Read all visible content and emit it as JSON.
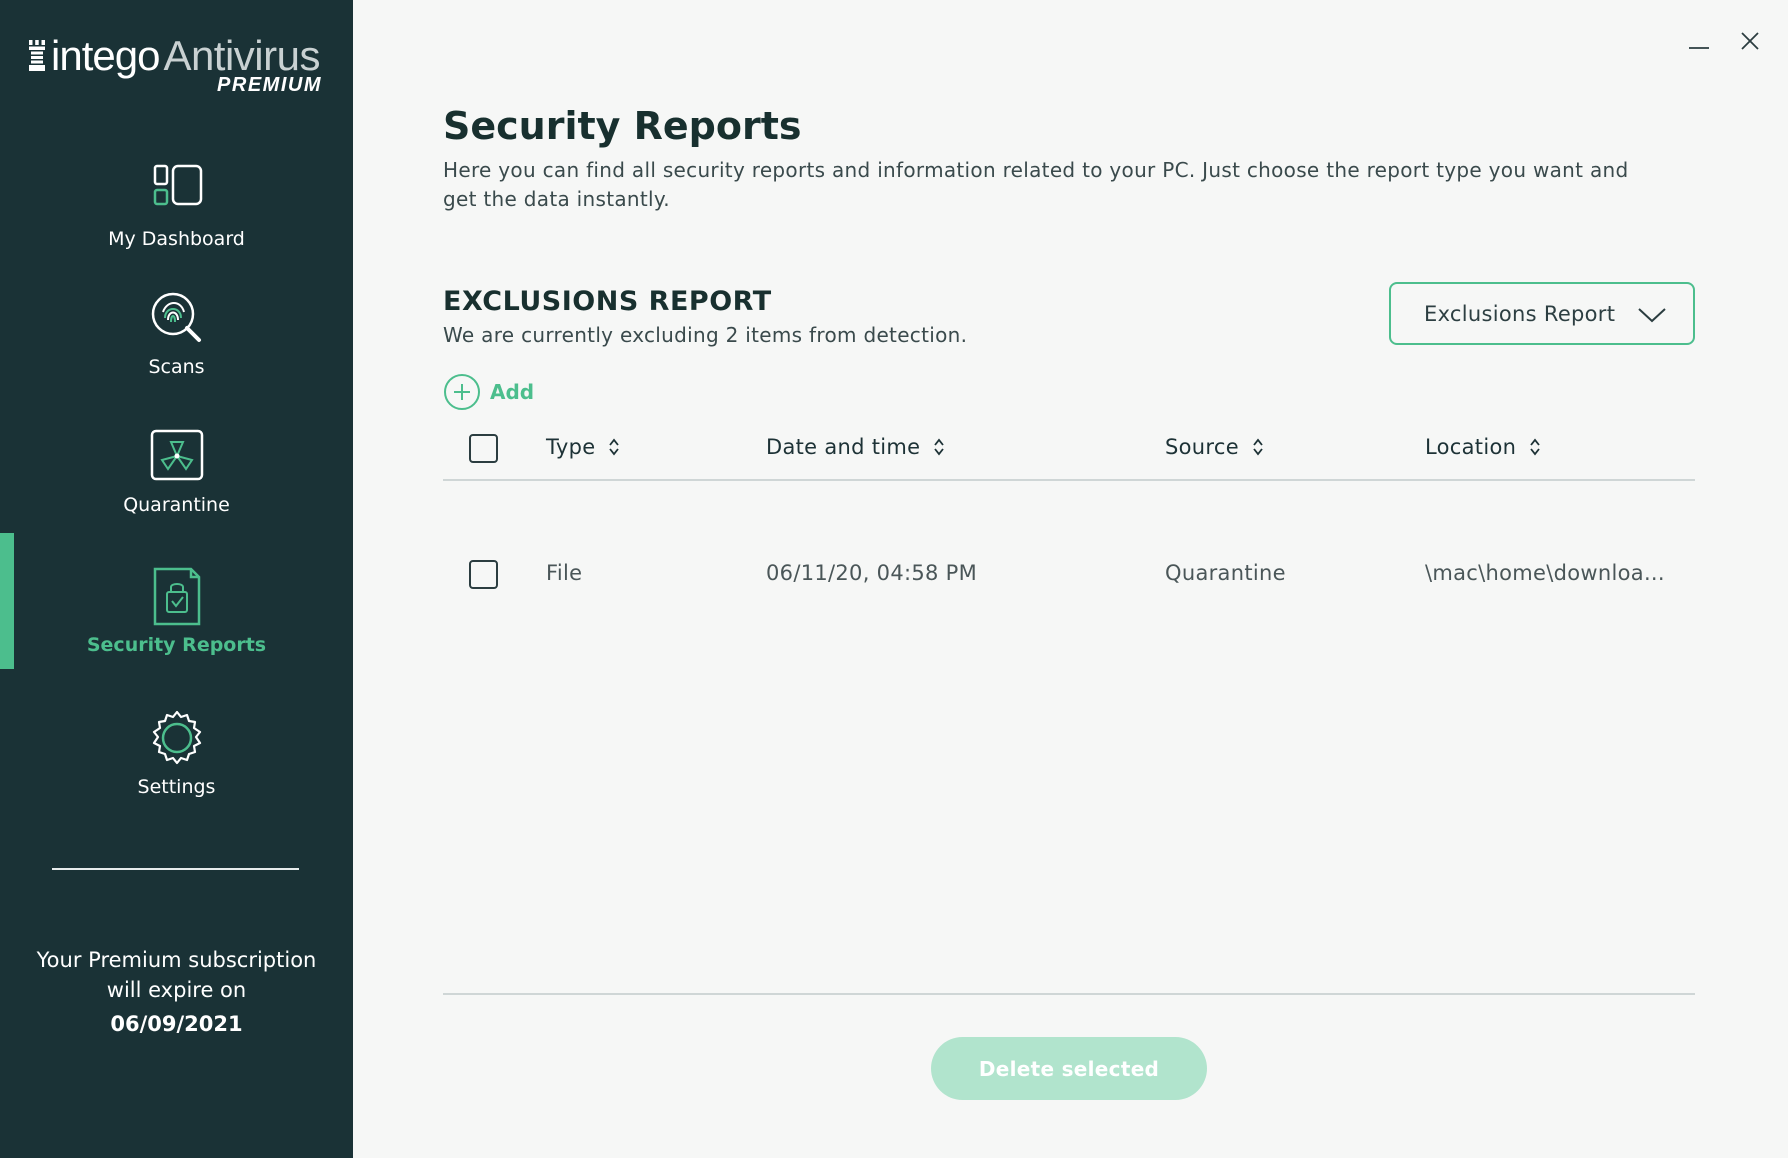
{
  "app": {
    "logo_brand": "intego",
    "logo_product": "Antivirus",
    "logo_tier": "PREMIUM"
  },
  "sidebar": {
    "items": [
      {
        "label": "My Dashboard",
        "icon": "dashboard-icon",
        "active": false
      },
      {
        "label": "Scans",
        "icon": "fingerprint-scan-icon",
        "active": false
      },
      {
        "label": "Quarantine",
        "icon": "quarantine-radiation-icon",
        "active": false
      },
      {
        "label": "Security Reports",
        "icon": "report-document-icon",
        "active": true
      },
      {
        "label": "Settings",
        "icon": "gear-icon",
        "active": false
      }
    ],
    "subscription_text": "Your Premium subscription will expire on",
    "subscription_date": "06/09/2021"
  },
  "header": {
    "title": "Security Reports",
    "description": "Here you can find all security reports and information related to your PC. Just choose the report type you want and get the data instantly."
  },
  "report": {
    "section_title": "EXCLUSIONS REPORT",
    "section_subtitle": "We are currently excluding 2 items from detection.",
    "selected_type": "Exclusions Report",
    "add_label": "Add"
  },
  "table": {
    "columns": [
      "Type",
      "Date and time",
      "Source",
      "Location"
    ],
    "rows": [
      {
        "type": "File",
        "date": "06/11/20, 04:58 PM",
        "source": "Quarantine",
        "location": "\\mac\\home\\downloa..."
      }
    ]
  },
  "footer": {
    "delete_label": "Delete selected"
  },
  "colors": {
    "sidebar_bg": "#1a3236",
    "accent": "#4cbe8d",
    "accent_disabled": "#b1e4cd",
    "page_bg": "#f6f7f6",
    "heading": "#18302f"
  }
}
